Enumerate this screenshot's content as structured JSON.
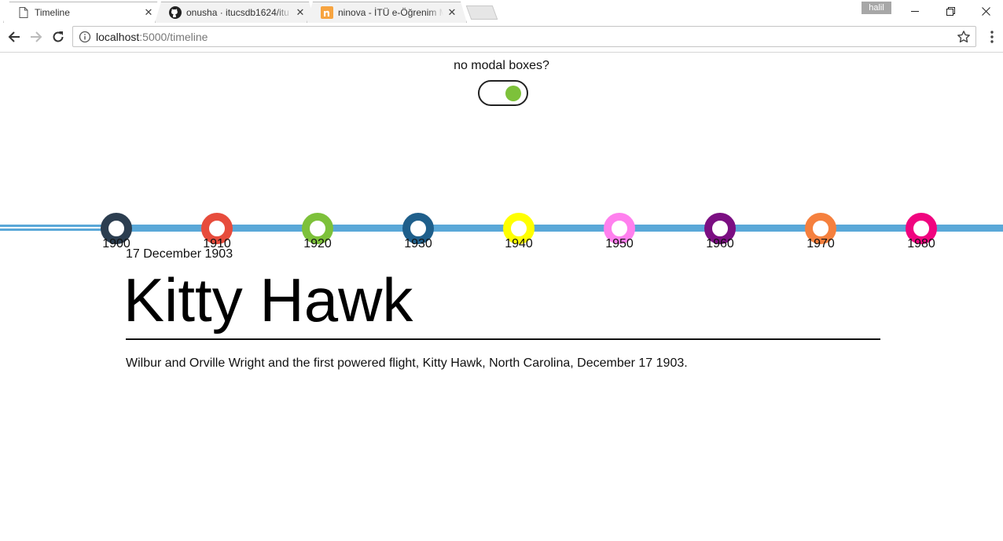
{
  "browser": {
    "tabs": [
      {
        "title": "Timeline",
        "favicon": "page-icon",
        "active": true
      },
      {
        "title": "onusha · itucsdb1624/itu",
        "favicon": "github-icon",
        "active": false
      },
      {
        "title": "ninova - İTÜ e-Öğrenim M",
        "favicon": "ninova-icon",
        "active": false
      }
    ],
    "profile_name": "halil",
    "url_host": "localhost",
    "url_path": ":5000/timeline"
  },
  "page": {
    "toggle_label": "no modal boxes?",
    "toggle_on": true,
    "timeline": {
      "rail_color": "#5aa8d8",
      "decades": [
        {
          "year": "1900",
          "color": "#2c3e50"
        },
        {
          "year": "1910",
          "color": "#e74c3c"
        },
        {
          "year": "1920",
          "color": "#7dc13a"
        },
        {
          "year": "1930",
          "color": "#1f5f8b"
        },
        {
          "year": "1940",
          "color": "#ffff00"
        },
        {
          "year": "1950",
          "color": "#ff80ee"
        },
        {
          "year": "1960",
          "color": "#7b0f82"
        },
        {
          "year": "1970",
          "color": "#f5803e"
        },
        {
          "year": "1980",
          "color": "#f0047f"
        }
      ]
    },
    "event": {
      "date": "17 December 1903",
      "title": "Kitty Hawk",
      "description": "Wilbur and Orville Wright and the first powered flight, Kitty Hawk, North Carolina, December 17 1903."
    }
  }
}
